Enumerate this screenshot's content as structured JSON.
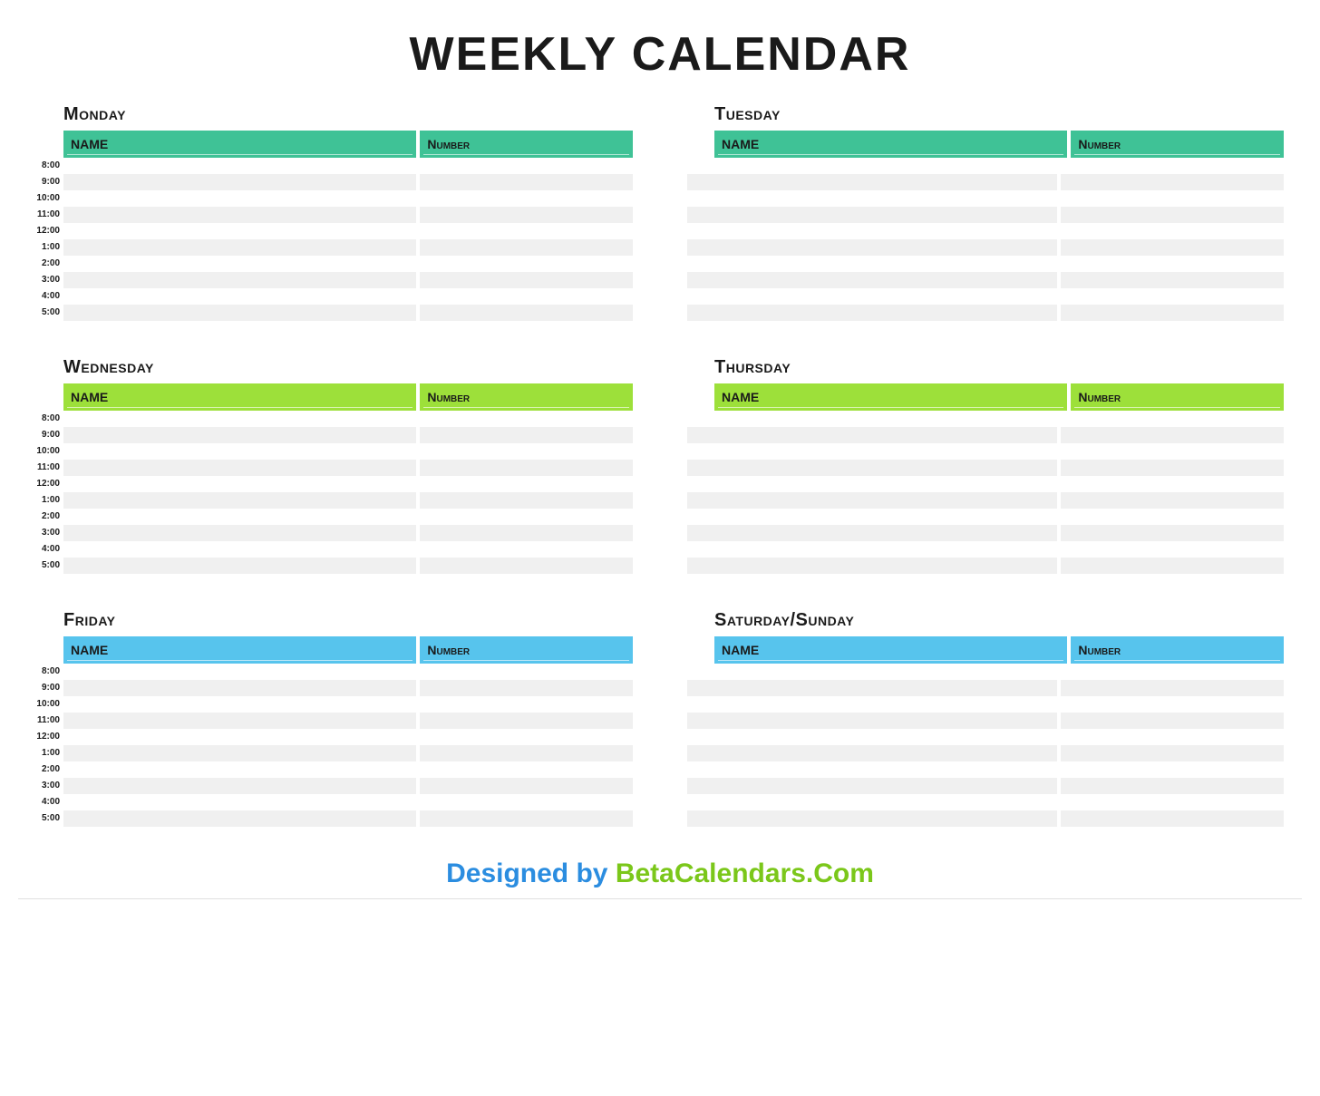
{
  "title": "WEEKLY CALENDAR",
  "columns": {
    "name": "NAME",
    "number": "Number"
  },
  "times": [
    "8:00",
    "9:00",
    "10:00",
    "11:00",
    "12:00",
    "1:00",
    "2:00",
    "3:00",
    "4:00",
    "5:00"
  ],
  "days": [
    {
      "label": "Monday",
      "theme": "teal"
    },
    {
      "label": "Tuesday",
      "theme": "teal"
    },
    {
      "label": "Wednesday",
      "theme": "lime"
    },
    {
      "label": "Thursday",
      "theme": "lime"
    },
    {
      "label": "Friday",
      "theme": "sky"
    },
    {
      "label": "Saturday/Sunday",
      "theme": "sky"
    }
  ],
  "footer": {
    "by": "Designed by ",
    "brand": "BetaCalendars.Com"
  }
}
